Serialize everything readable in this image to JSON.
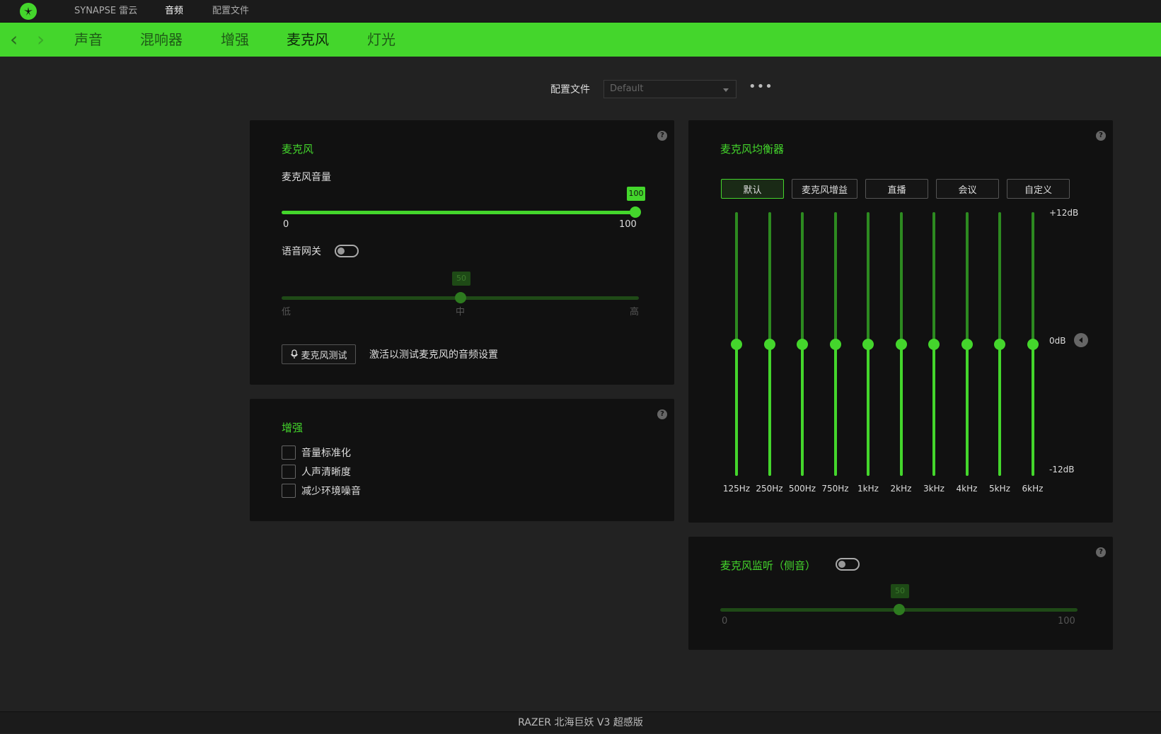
{
  "titlebar": {
    "app_name": "SYNAPSE 雷云",
    "tabs": [
      "音频",
      "配置文件"
    ]
  },
  "subnav": {
    "tabs": [
      "声音",
      "混响器",
      "增强",
      "麦克风",
      "灯光"
    ],
    "active_index": 3
  },
  "profile": {
    "label": "配置文件",
    "value": "Default",
    "more": "•••"
  },
  "mic_panel": {
    "title": "麦克风",
    "volume_label": "麦克风音量",
    "volume_value": "100",
    "volume_min": "0",
    "volume_max": "100",
    "volume_level": 100,
    "gate_label": "语音网关",
    "gate_enabled": false,
    "gate_value": "50",
    "gate_level": 50,
    "gate_low": "低",
    "gate_mid": "中",
    "gate_high": "高",
    "test_button": "麦克风测试",
    "test_hint": "激活以测试麦克风的音频设置"
  },
  "enhance_panel": {
    "title": "增强",
    "options": [
      "音量标准化",
      "人声清晰度",
      "减少环境噪音"
    ]
  },
  "eq_panel": {
    "title": "麦克风均衡器",
    "presets": [
      "默认",
      "麦克风增益",
      "直播",
      "会议",
      "自定义"
    ],
    "active_preset": 0,
    "bands": [
      "125Hz",
      "250Hz",
      "500Hz",
      "750Hz",
      "1kHz",
      "2kHz",
      "3kHz",
      "4kHz",
      "5kHz",
      "6kHz"
    ],
    "band_values_db": [
      0,
      0,
      0,
      0,
      0,
      0,
      0,
      0,
      0,
      0
    ],
    "db_max": "+12dB",
    "db_mid": "0dB",
    "db_min": "-12dB"
  },
  "monitor_panel": {
    "title": "麦克风监听（侧音）",
    "enabled": false,
    "value": "50",
    "level": 50,
    "min": "0",
    "max": "100"
  },
  "status": {
    "device_name": "RAZER 北海巨妖 V3 超感版"
  },
  "colors": {
    "accent": "#44d62c",
    "background": "#222222",
    "panel": "#111111"
  }
}
